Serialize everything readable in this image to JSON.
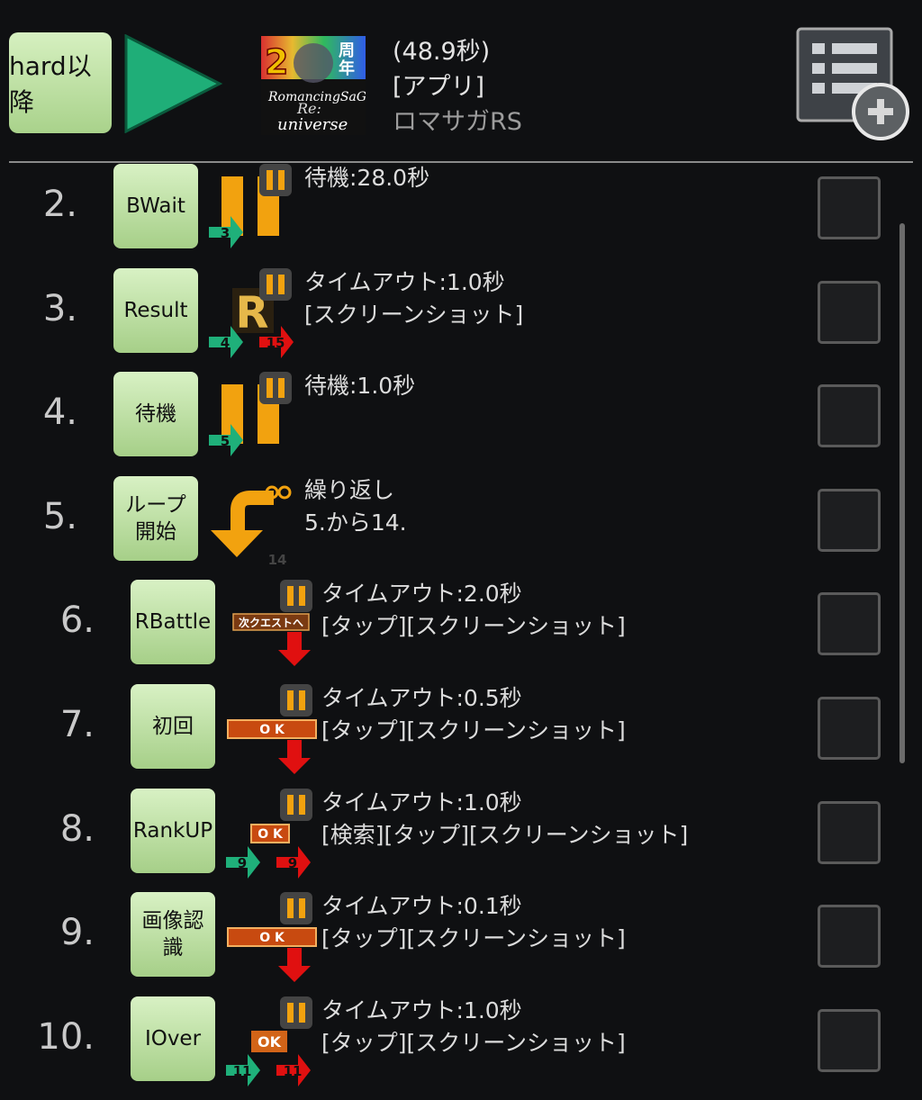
{
  "header": {
    "macro_button": "hard以降",
    "time": "(48.9秒)",
    "category": "[アプリ]",
    "app_name": "ロマサガRS",
    "icon": "romasaga-rs-app-icon",
    "icon_badge_number": "2",
    "icon_badge_text": "周年"
  },
  "rows": [
    {
      "num": "2.",
      "label": "BWait",
      "type": "wait",
      "lines": [
        "待機:28.0秒"
      ],
      "next": "3"
    },
    {
      "num": "3.",
      "label": "Result",
      "type": "image",
      "lines": [
        "タイムアウト:1.0秒",
        "[スクリーンショット]"
      ],
      "next": "4",
      "alt": "15",
      "thumb": "R"
    },
    {
      "num": "4.",
      "label": "待機",
      "type": "wait",
      "lines": [
        "待機:1.0秒"
      ],
      "next": "5"
    },
    {
      "num": "5.",
      "label": "ループ開始",
      "type": "loop",
      "lines": [
        "繰り返し",
        "5.から14."
      ],
      "end": "14"
    },
    {
      "num": "6.",
      "label": "RBattle",
      "type": "tap",
      "lines": [
        "タイムアウト:2.0秒",
        "[タップ][スクリーンショット]"
      ],
      "thumb": "次クエストへ"
    },
    {
      "num": "7.",
      "label": "初回",
      "type": "tap",
      "lines": [
        "タイムアウト:0.5秒",
        "[タップ][スクリーンショット]"
      ],
      "thumb": "O K"
    },
    {
      "num": "8.",
      "label": "RankUP",
      "type": "search",
      "lines": [
        "タイムアウト:1.0秒",
        "[検索][タップ][スクリーンショット]"
      ],
      "next": "9",
      "alt": "9",
      "thumb": "O K"
    },
    {
      "num": "9.",
      "label": "画像認識",
      "type": "tap",
      "lines": [
        "タイムアウト:0.1秒",
        "[タップ][スクリーンショット]"
      ],
      "thumb": "O K"
    },
    {
      "num": "10.",
      "label": "IOver",
      "type": "search",
      "lines": [
        "タイムアウト:1.0秒",
        "[タップ][スクリーンショット]"
      ],
      "next": "11",
      "alt": "11",
      "thumb": "OK"
    }
  ],
  "colors": {
    "accent_green": "#1fb07a",
    "arrow_red": "#e01010",
    "wait_orange": "#f2a20f",
    "button_green": "#bfe3a3"
  }
}
